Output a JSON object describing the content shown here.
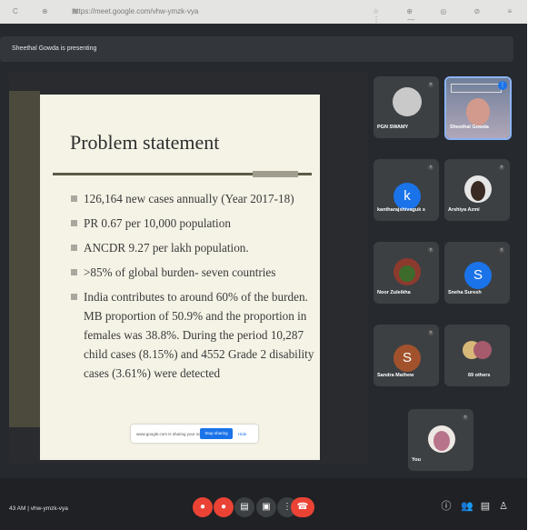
{
  "browser": {
    "nav_icons": "C ⊕ ⊞",
    "url": "https://meet.google.com/vhw-ymzk-vya",
    "tool_icons": "☆ ⊕ ◎ ⊘ ≡ ⋮ —"
  },
  "presenting_banner": "Sheethal Gowda is presenting",
  "slide": {
    "title": "Problem statement",
    "bullets": [
      "126,164 new cases annually (Year 2017-18)",
      "PR 0.67 per 10,000 population",
      "ANCDR 9.27 per lakh population.",
      ">85% of global burden- seven countries",
      "India contributes to around 60% of the burden. MB proportion of 50.9% and the proportion in females was 38.8%. During the period 10,287 child cases (8.15%) and 4552 Grade 2 disability cases (3.61%) were detected"
    ],
    "popup": {
      "text": "www.google.com is sharing your screen",
      "stop_button": "Stop sharing",
      "hide_link": "Hide"
    }
  },
  "participants": [
    {
      "name": "PGN SWAMY",
      "avatar": "",
      "avatar_color": "#b9b9b9"
    },
    {
      "name": "Sheethal Gowda",
      "avatar": "",
      "avatar_color": ""
    },
    {
      "name": "kantharajshivaguk s",
      "avatar": "k",
      "avatar_color": "#1a73e8"
    },
    {
      "name": "Arshiya Azmi",
      "avatar": "",
      "avatar_color": ""
    },
    {
      "name": "Noor Zuleikha",
      "avatar": "",
      "avatar_color": ""
    },
    {
      "name": "Sneha Suresh",
      "avatar": "S",
      "avatar_color": "#1a73e8"
    },
    {
      "name": "Sandra Mathew",
      "avatar": "S",
      "avatar_color": "#a1522c"
    },
    {
      "name": "69 others",
      "avatar": "",
      "avatar_color": ""
    },
    {
      "name": "You",
      "avatar": "",
      "avatar_color": ""
    }
  ],
  "bottom": {
    "meeting_info": "43 AM | vhw-ymzk-vya"
  },
  "colors": {
    "end_call": "#ea4335",
    "mic_off": "#ea4335",
    "accent_blue": "#1a73e8"
  }
}
